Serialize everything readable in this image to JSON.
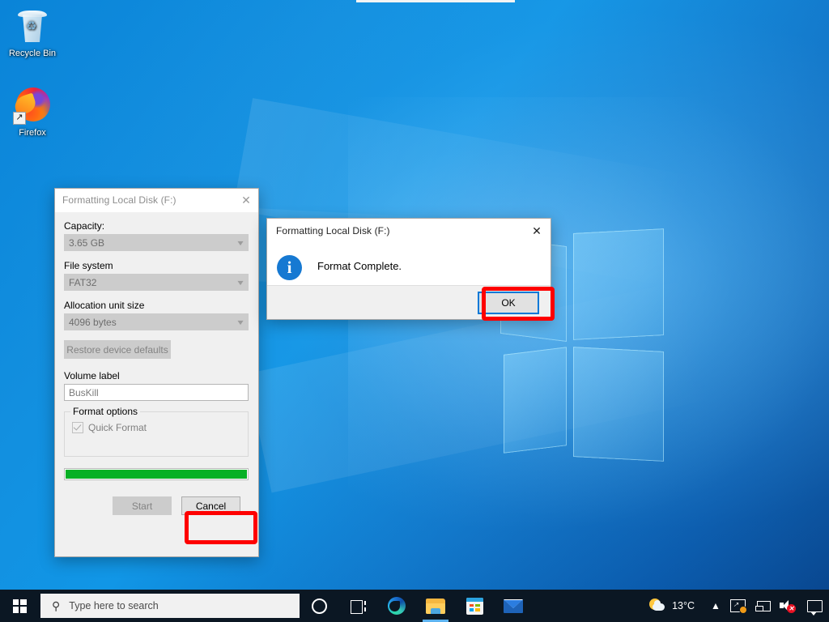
{
  "desktop": {
    "icons": [
      {
        "label": "Recycle Bin",
        "icon": "recycle-bin-icon"
      },
      {
        "label": "Firefox",
        "icon": "firefox-icon"
      }
    ]
  },
  "format_dialog": {
    "title": "Formatting Local Disk (F:)",
    "close_label": "✕",
    "capacity": {
      "label": "Capacity:",
      "value": "3.65 GB"
    },
    "file_system": {
      "label": "File system",
      "value": "FAT32"
    },
    "allocation_unit": {
      "label": "Allocation unit size",
      "value": "4096 bytes"
    },
    "restore_defaults_label": "Restore device defaults",
    "volume_label": {
      "label": "Volume label",
      "value": "BusKill"
    },
    "format_options": {
      "group_label": "Format options",
      "quick_format_label": "Quick Format",
      "quick_format_checked": true
    },
    "progress": {
      "percent": 100,
      "color": "#06b025"
    },
    "start_label": "Start",
    "cancel_label": "Cancel"
  },
  "message_box": {
    "title": "Formatting Local Disk (F:)",
    "close_label": "✕",
    "icon": "info-icon",
    "message": "Format Complete.",
    "ok_label": "OK",
    "accent": "#0078d7"
  },
  "annotations": {
    "color": "#fe0000",
    "targets": [
      "cancel-button",
      "ok-button"
    ]
  },
  "taskbar": {
    "start_label": "Start",
    "search_placeholder": "Type here to search",
    "search_icon": "search-icon",
    "buttons": [
      {
        "name": "cortana-button",
        "icon": "circle-icon"
      },
      {
        "name": "task-view-button",
        "icon": "task-view-icon"
      },
      {
        "name": "edge-button",
        "icon": "edge-icon"
      },
      {
        "name": "file-explorer-button",
        "icon": "folder-icon",
        "active": true
      },
      {
        "name": "microsoft-store-button",
        "icon": "store-icon"
      },
      {
        "name": "mail-button",
        "icon": "mail-icon"
      }
    ],
    "tray": {
      "weather_temp": "13°C",
      "weather_icon": "sun-cloud-icon",
      "show_hidden_icon": "chevron-up-icon",
      "network_icon": "network-warning-icon",
      "display_icon": "display-icon",
      "volume_icon": "volume-muted-icon",
      "action_center_icon": "action-center-icon"
    }
  }
}
